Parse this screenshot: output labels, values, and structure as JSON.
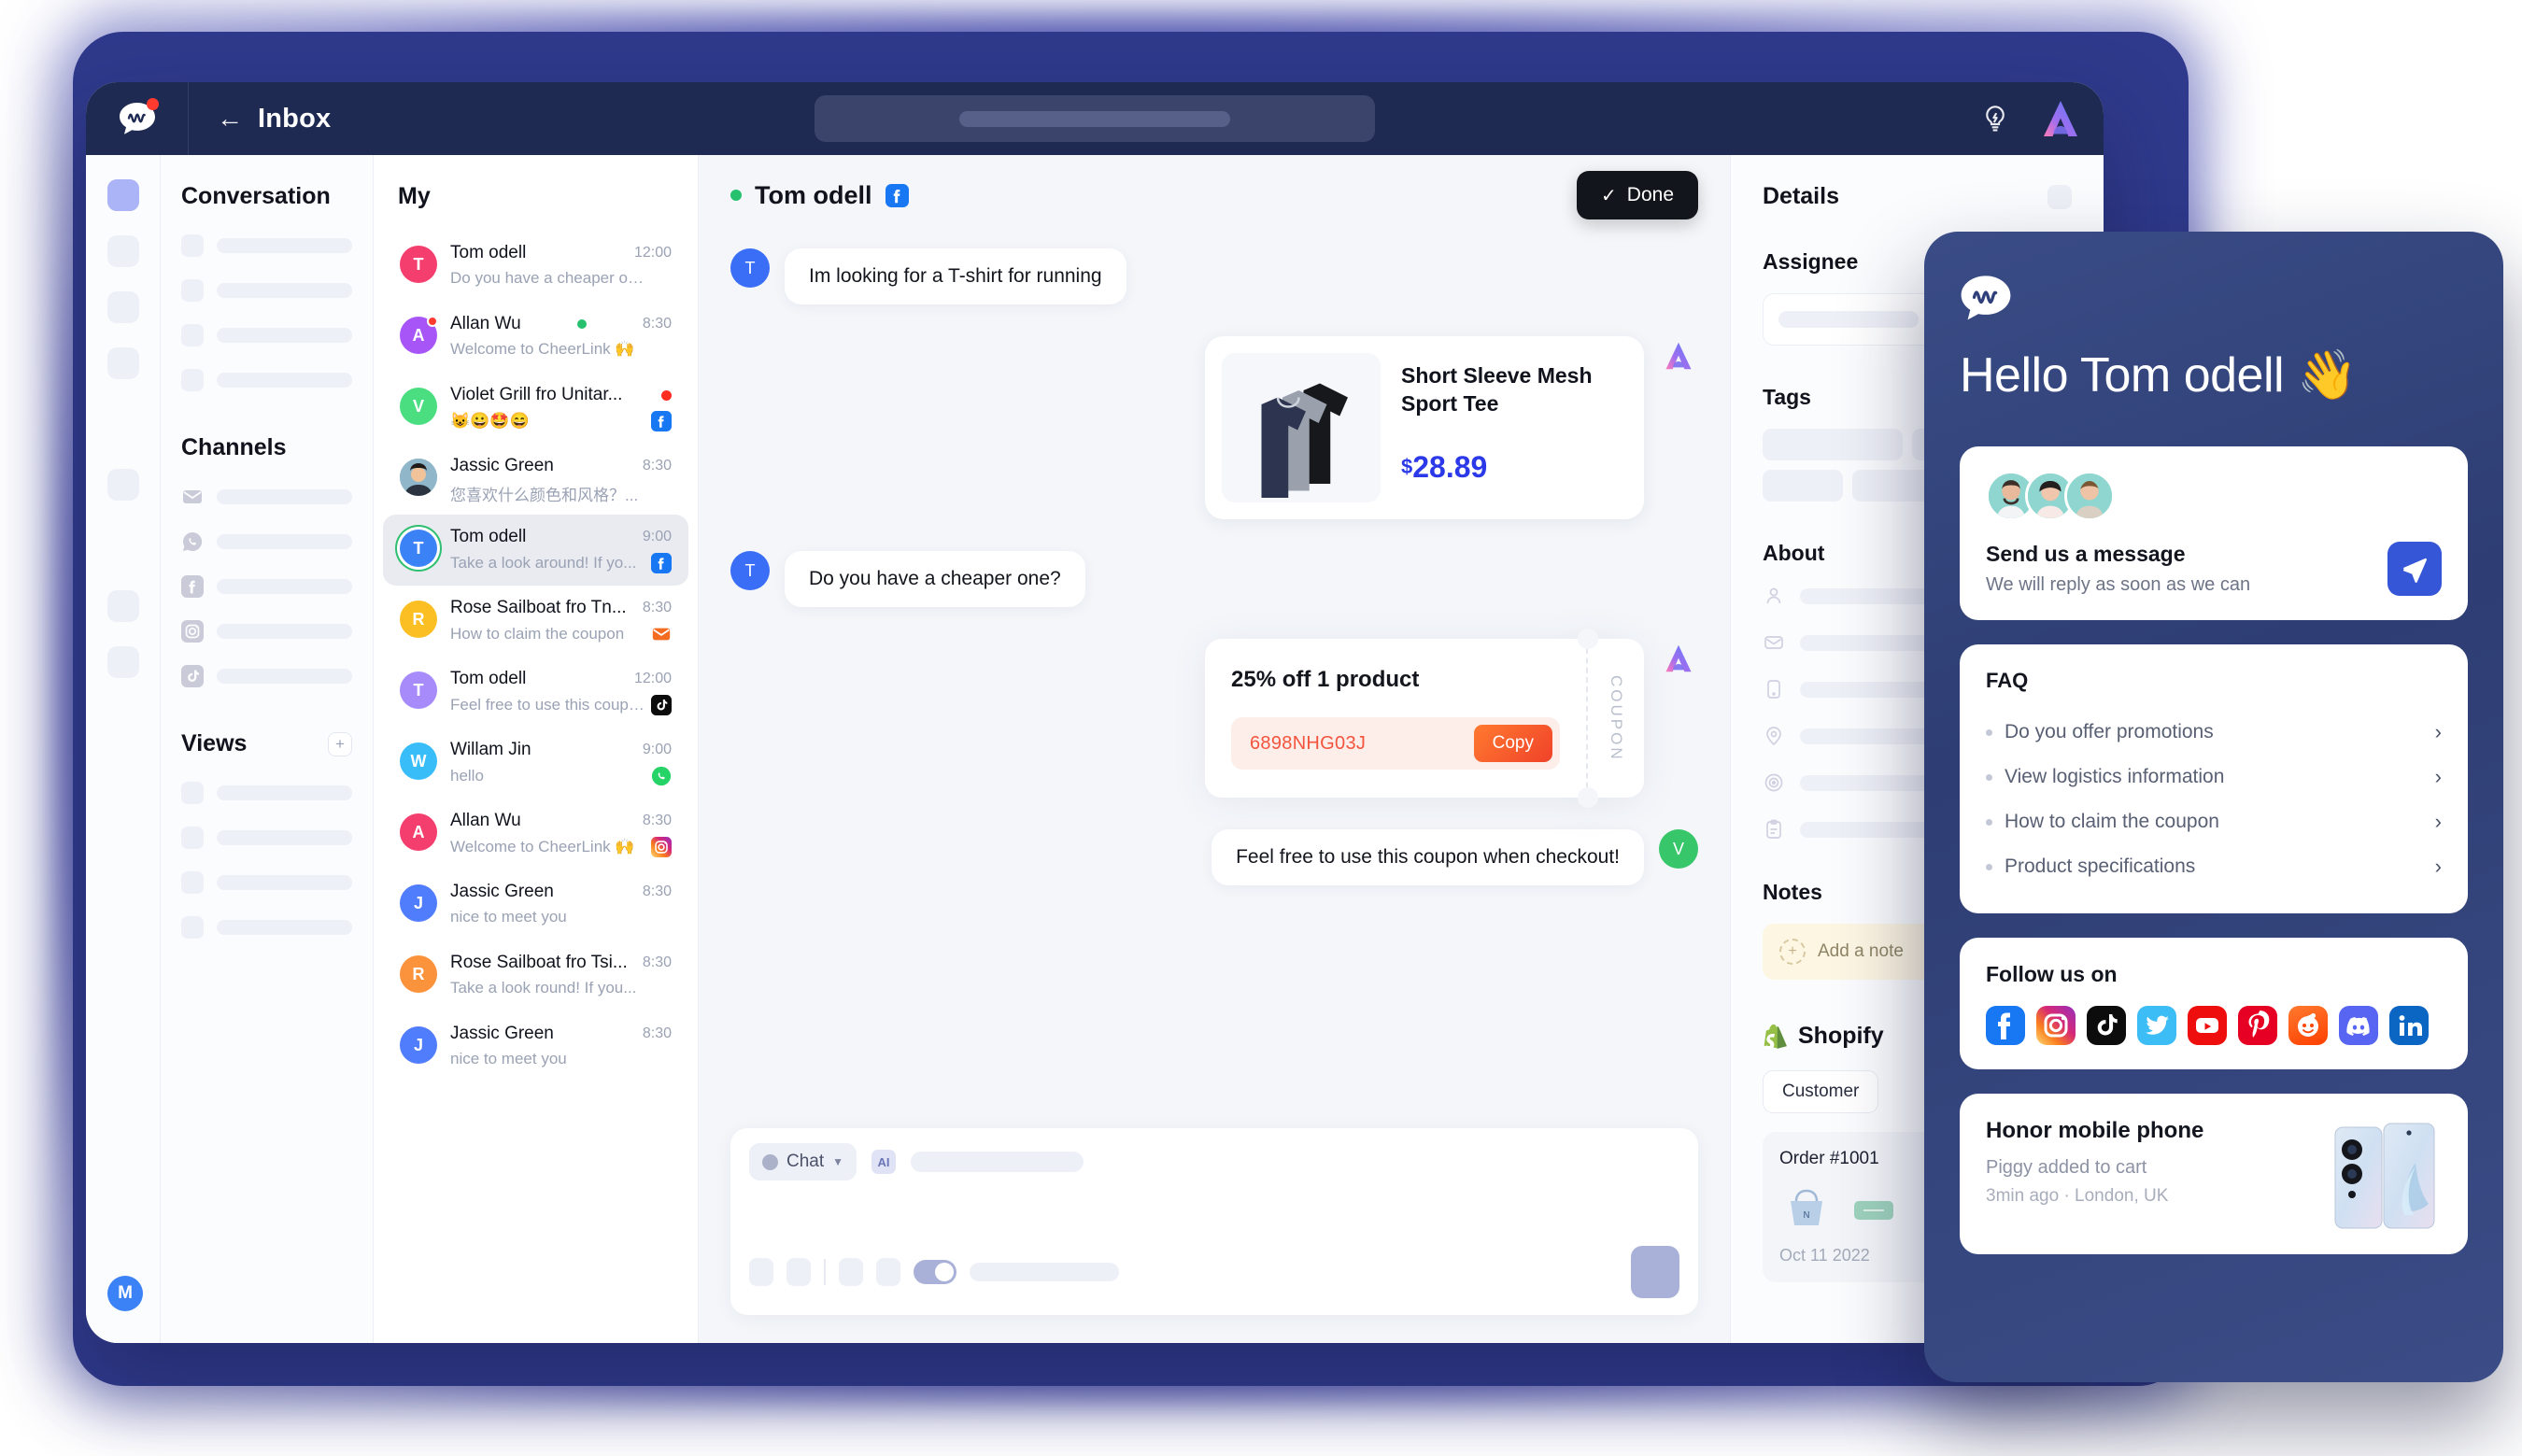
{
  "window": {
    "topbar": {
      "logo_icon": "cheerlink-bubble-logo",
      "notification_dot": true,
      "back_icon": "back-arrow-icon",
      "title": "Inbox",
      "search_placeholder": "",
      "bulb_icon": "idea-bolt-icon",
      "brand_icon": "brand-a-logo"
    },
    "rail": {
      "user_initial": "M"
    },
    "nav": {
      "conversation_title": "Conversation",
      "channels_title": "Channels",
      "views_title": "Views",
      "add_view_label": "+",
      "channel_icons": [
        "email-icon",
        "whatsapp-icon",
        "facebook-icon",
        "instagram-icon",
        "tiktok-icon"
      ]
    },
    "list": {
      "title": "My",
      "items": [
        {
          "name": "Tom odell",
          "preview": "Do you have a cheaper one?",
          "time": "12:00",
          "initial": "T",
          "color": "#f43f6e",
          "channel": "",
          "online": false,
          "unread": false,
          "selected": false
        },
        {
          "name": "Allan Wu",
          "preview": "Welcome to CheerLink 🙌",
          "time": "8:30",
          "initial": "A",
          "color": "#a855f7",
          "channel": "",
          "online": true,
          "unread": true,
          "selected": false
        },
        {
          "name": "Violet Grill fro Unitar...",
          "preview": "😺😀🤩😄",
          "time": "",
          "initial": "V",
          "color": "#4ade80",
          "channel": "facebook",
          "online": false,
          "unread": true,
          "selected": false
        },
        {
          "name": "Jassic Green",
          "preview": "您喜欢什么颜色和风格？...",
          "time": "8:30",
          "initial": "",
          "color": "#8fb6c9",
          "channel": "",
          "online": false,
          "unread": false,
          "selected": false,
          "photo": true
        },
        {
          "name": "Tom odell",
          "preview": "Take a look around! If yo...",
          "time": "9:00",
          "initial": "T",
          "color": "#3b82f6",
          "channel": "facebook",
          "online": false,
          "unread": false,
          "selected": true,
          "ring": true
        },
        {
          "name": "Rose Sailboat fro Tn...",
          "preview": "How to claim the coupon",
          "time": "8:30",
          "initial": "R",
          "color": "#fbbf24",
          "channel": "email",
          "online": false,
          "unread": false,
          "selected": false
        },
        {
          "name": "Tom odell",
          "preview": "Feel free to use this coupon...",
          "time": "12:00",
          "initial": "T",
          "color": "#a78bfa",
          "channel": "tiktok",
          "online": false,
          "unread": false,
          "selected": false
        },
        {
          "name": "Willam Jin",
          "preview": "hello",
          "time": "9:00",
          "initial": "W",
          "color": "#38bdf8",
          "channel": "whatsapp",
          "online": false,
          "unread": false,
          "selected": false
        },
        {
          "name": "Allan Wu",
          "preview": "Welcome to CheerLink 🙌",
          "time": "8:30",
          "initial": "A",
          "color": "#f43f6e",
          "channel": "instagram",
          "online": false,
          "unread": false,
          "selected": false
        },
        {
          "name": "Jassic Green",
          "preview": "nice to meet you",
          "time": "8:30",
          "initial": "J",
          "color": "#4f7dfb",
          "channel": "",
          "online": false,
          "unread": false,
          "selected": false
        },
        {
          "name": "Rose Sailboat fro Tsi...",
          "preview": "Take a look round! If you...",
          "time": "8:30",
          "initial": "R",
          "color": "#fb923c",
          "channel": "",
          "online": false,
          "unread": false,
          "selected": false
        },
        {
          "name": "Jassic Green",
          "preview": "nice to meet you",
          "time": "8:30",
          "initial": "J",
          "color": "#4f7dfb",
          "channel": "",
          "online": false,
          "unread": false,
          "selected": false
        }
      ]
    },
    "chat": {
      "contact_name": "Tom odell",
      "contact_channel": "facebook",
      "online": true,
      "done_label": "Done",
      "messages": [
        {
          "side": "left",
          "avatar": "T",
          "text": "Im looking for a T-shirt for running"
        },
        {
          "side": "right",
          "type": "product"
        },
        {
          "side": "left",
          "avatar": "T",
          "text": "Do you have a cheaper one?"
        },
        {
          "side": "right",
          "type": "coupon"
        },
        {
          "side": "right",
          "avatar": "V",
          "text": "Feel free to use this coupon when checkout!"
        }
      ],
      "product": {
        "title": "Short Sleeve Mesh Sport Tee",
        "currency": "$",
        "price": "28.89"
      },
      "coupon": {
        "title": "25% off 1 product",
        "code": "6898NHG03J",
        "copy_label": "Copy",
        "side_label": "COUPON"
      },
      "composer": {
        "mode_label": "Chat",
        "ai_label": "AI"
      }
    },
    "details": {
      "title": "Details",
      "assignee_label": "Assignee",
      "tags_label": "Tags",
      "about_label": "About",
      "about_icons": [
        "person-icon",
        "email-icon",
        "phone-icon",
        "location-icon",
        "target-icon",
        "clipboard-icon"
      ],
      "notes_label": "Notes",
      "add_note_label": "Add a note",
      "shopify_label": "Shopify",
      "customer_label": "Customer",
      "order_id": "Order #1001",
      "order_date": "Oct 11 2022"
    }
  },
  "widget": {
    "logo_icon": "cheerlink-bubble-logo",
    "greeting": "Hello Tom odell 👋",
    "message_card": {
      "title": "Send us a message",
      "subtitle": "We will reply as soon as we can",
      "send_icon": "send-plane-icon"
    },
    "faq": {
      "title": "FAQ",
      "items": [
        "Do you offer promotions",
        "View logistics information",
        "How to claim the coupon",
        "Product specifications"
      ]
    },
    "follow": {
      "title": "Follow us on",
      "networks": [
        {
          "name": "facebook",
          "color": "#1877f2"
        },
        {
          "name": "instagram",
          "color": "#e1306c"
        },
        {
          "name": "tiktok",
          "color": "#0c0c0c"
        },
        {
          "name": "twitter",
          "color": "#3dbdf5"
        },
        {
          "name": "youtube",
          "color": "#ef0e0e"
        },
        {
          "name": "pinterest",
          "color": "#e60023"
        },
        {
          "name": "reddit",
          "color": "#ff4500"
        },
        {
          "name": "discord",
          "color": "#5865f2"
        },
        {
          "name": "linkedin",
          "color": "#0a66c2"
        }
      ]
    },
    "product_card": {
      "title": "Honor mobile phone",
      "subtitle": "Piggy added to cart",
      "meta": "3min ago · London, UK"
    }
  }
}
